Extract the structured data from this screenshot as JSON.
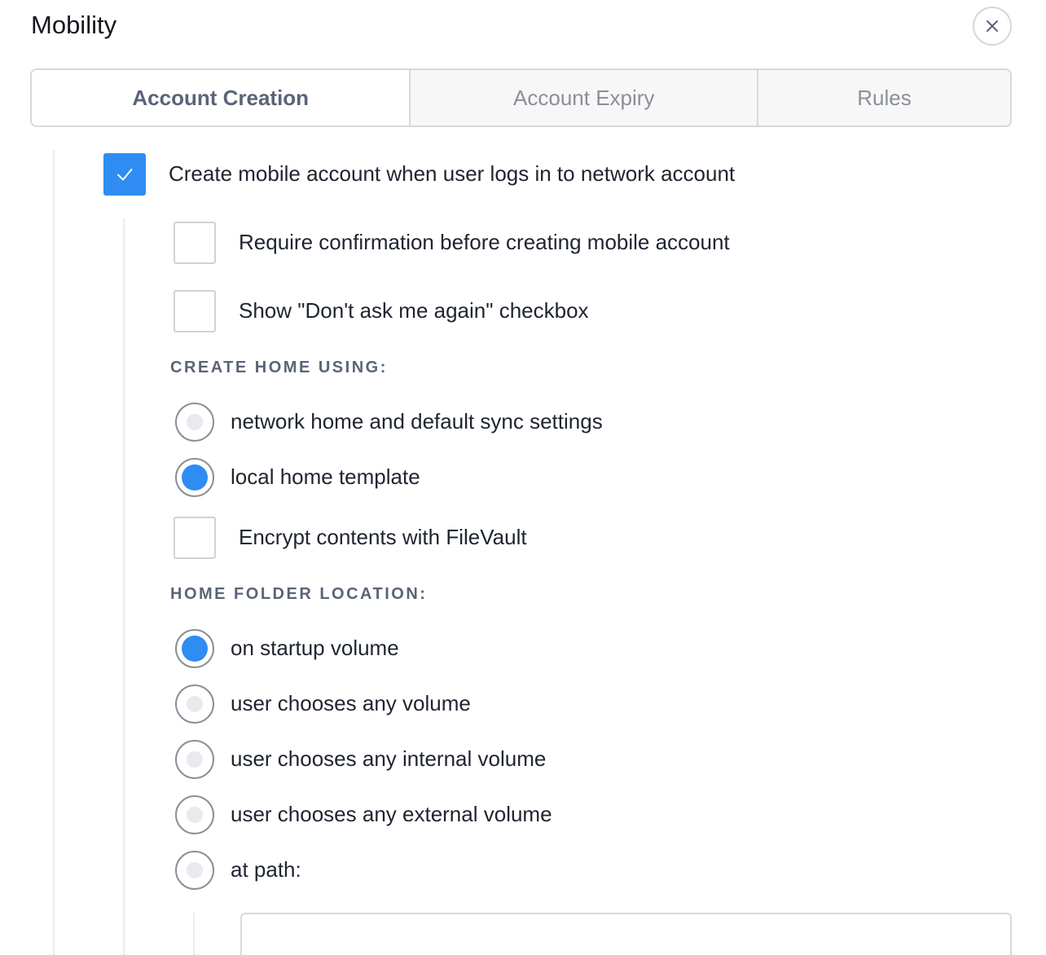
{
  "window": {
    "title": "Mobility",
    "close_icon": "close-icon"
  },
  "tabs": [
    {
      "label": "Account Creation",
      "active": true
    },
    {
      "label": "Account Expiry",
      "active": false
    },
    {
      "label": "Rules",
      "active": false
    }
  ],
  "account_creation": {
    "create_mobile": {
      "label": "Create mobile account when user logs in to network account",
      "checked": true
    },
    "require_confirmation": {
      "label": "Require confirmation before creating mobile account",
      "checked": false
    },
    "show_dont_ask": {
      "label": "Show \"Don't ask me again\" checkbox",
      "checked": false
    },
    "create_home_heading": "CREATE HOME USING:",
    "create_home_options": [
      {
        "label": "network home and default sync settings",
        "selected": false
      },
      {
        "label": "local home template",
        "selected": true
      }
    ],
    "encrypt_filevault": {
      "label": "Encrypt contents with FileVault",
      "checked": false
    },
    "home_folder_heading": "HOME FOLDER LOCATION:",
    "home_folder_options": [
      {
        "label": "on startup volume",
        "selected": true
      },
      {
        "label": "user chooses any volume",
        "selected": false
      },
      {
        "label": "user chooses any internal volume",
        "selected": false
      },
      {
        "label": "user chooses any external volume",
        "selected": false
      },
      {
        "label": "at path:",
        "selected": false
      }
    ],
    "path_value": "",
    "path_placeholder": ""
  },
  "colors": {
    "accent": "#2f8cf2",
    "border": "#d5d8de",
    "heading": "#5a6479",
    "muted_text": "#8a8f98"
  }
}
